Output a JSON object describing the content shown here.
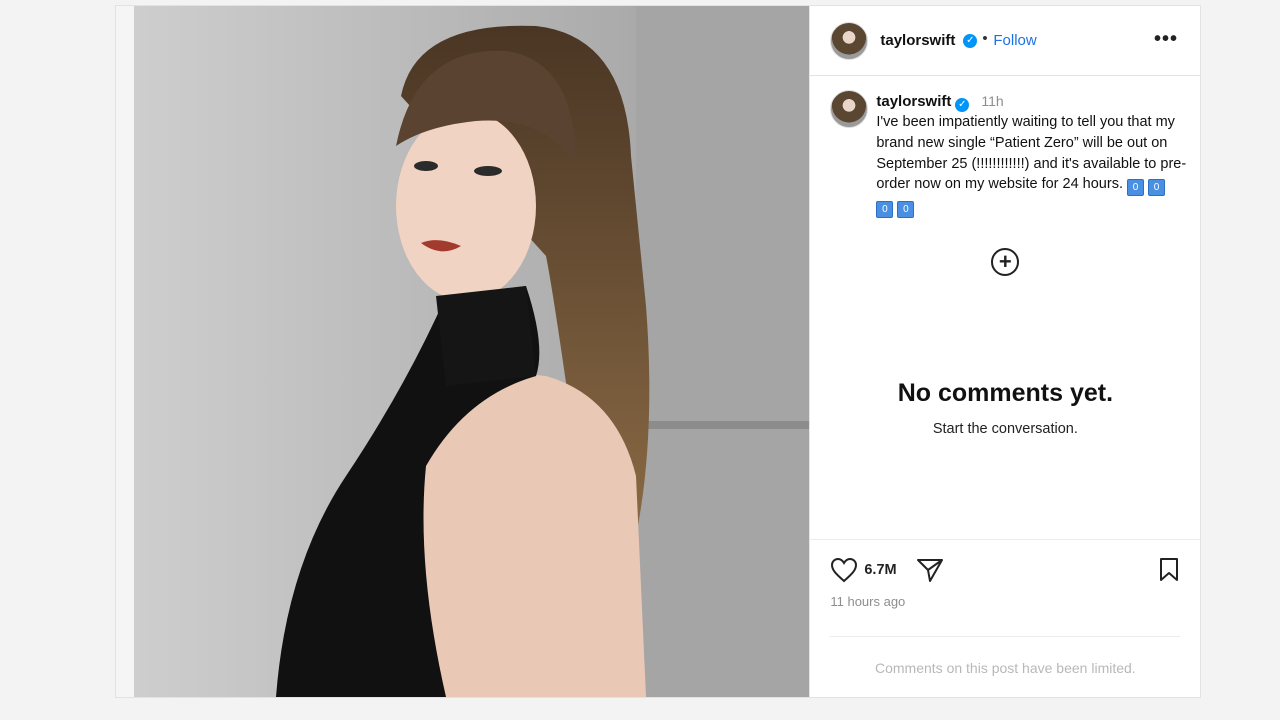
{
  "header": {
    "username": "taylorswift",
    "separator": "•",
    "follow_label": "Follow",
    "more_label": "•••"
  },
  "caption": {
    "username": "taylorswift",
    "time": "11h",
    "text": "I've been impatiently waiting to tell you that my brand new single “Patient Zero” will be out on September 25 (!!!!!!!!!!!!) and it's available to pre-order now on my website for 24 hours.",
    "emojis": [
      "0",
      "0",
      "0",
      "0"
    ]
  },
  "comments": {
    "empty_title": "No comments yet.",
    "empty_subtitle": "Start the conversation."
  },
  "actions": {
    "likes": "6.7M",
    "posted_ago": "11 hours ago"
  },
  "footer": {
    "limited_notice": "Comments on this post have been limited."
  },
  "icons": {
    "verified": "verified-badge-icon",
    "heart": "heart-icon",
    "share": "share-icon",
    "bookmark": "bookmark-icon",
    "add": "add-comment-icon"
  },
  "colors": {
    "link": "#1a73e8",
    "verified": "#0095f6",
    "muted": "#8e8e8e"
  }
}
